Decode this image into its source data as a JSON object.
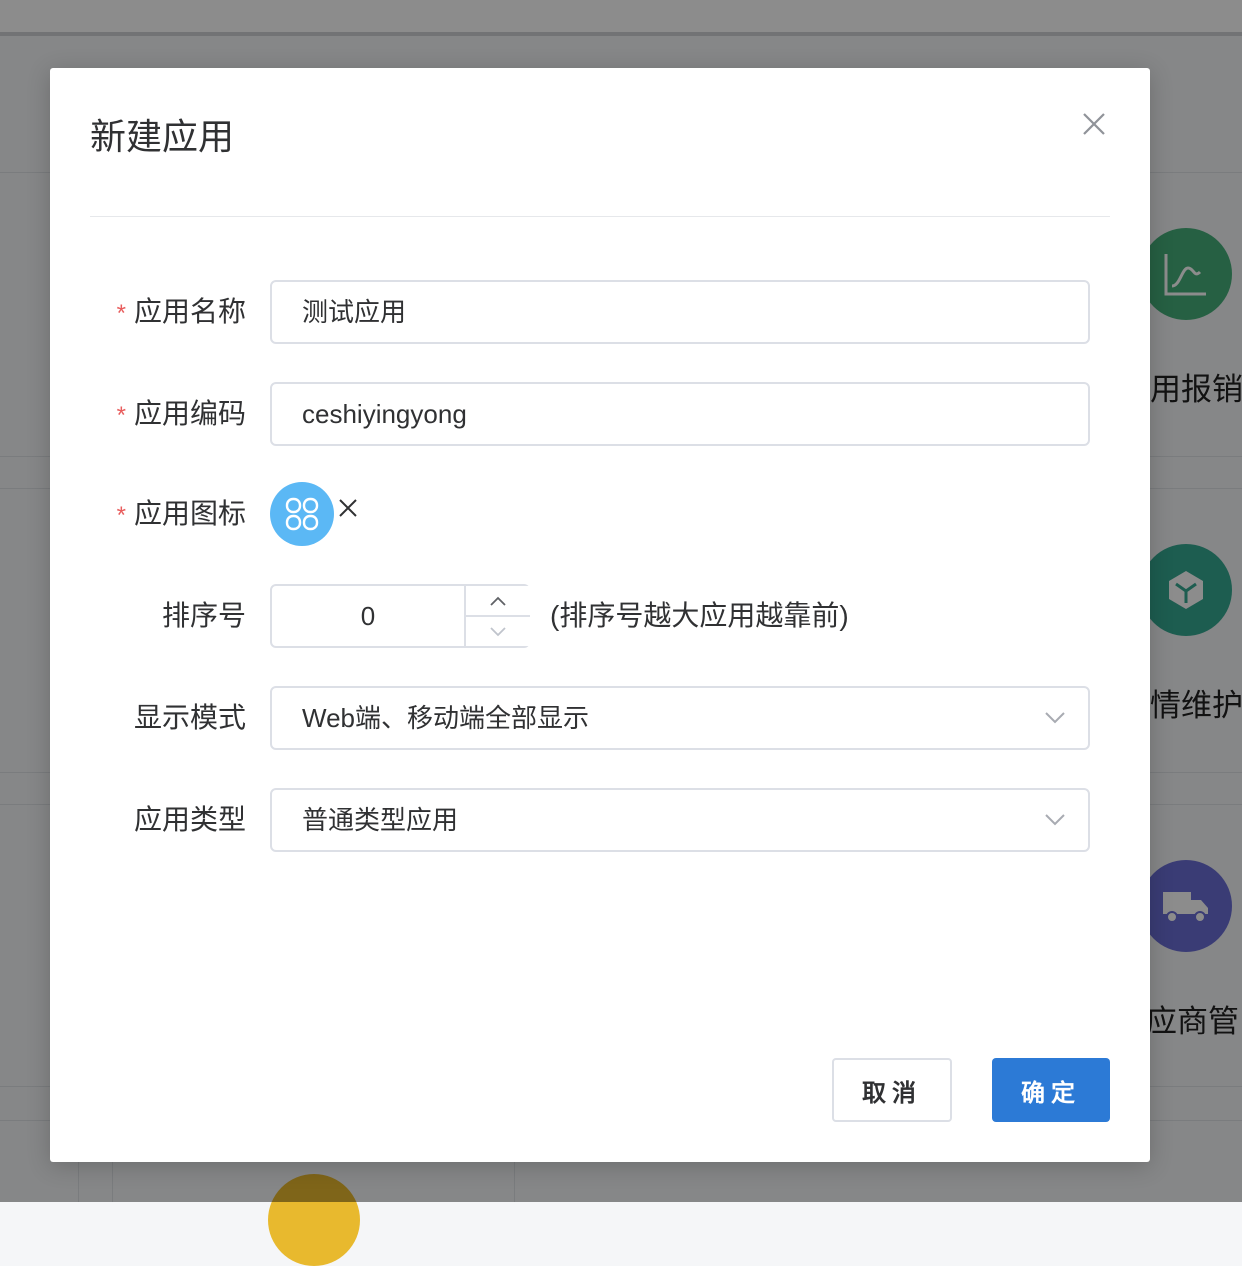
{
  "background": {
    "cards": [
      {
        "label": "用报销",
        "color": "#45b07a",
        "icon": "line-chart-icon"
      },
      {
        "label": "情维护",
        "color": "#36a992",
        "icon": "box-icon"
      },
      {
        "label": "应商管",
        "color": "#6b6ed6",
        "icon": "truck-icon"
      }
    ],
    "bottom_circle_color": "#e8b92e"
  },
  "dialog": {
    "title": "新建应用",
    "fields": {
      "name": {
        "label": "应用名称",
        "value": "测试应用",
        "required": true
      },
      "code": {
        "label": "应用编码",
        "value": "ceshiyingyong",
        "required": true
      },
      "icon": {
        "label": "应用图标",
        "icon": "app-clover-icon",
        "color": "#5bb8f5",
        "required": true
      },
      "sort": {
        "label": "排序号",
        "value": "0",
        "hint": "(排序号越大应用越靠前)"
      },
      "display_mode": {
        "label": "显示模式",
        "value": "Web端、移动端全部显示"
      },
      "app_type": {
        "label": "应用类型",
        "value": "普通类型应用"
      }
    },
    "required_mark": "*",
    "buttons": {
      "cancel": "取消",
      "ok": "确定"
    },
    "colors": {
      "primary": "#2c7ad6",
      "required": "#e85d5d"
    }
  }
}
